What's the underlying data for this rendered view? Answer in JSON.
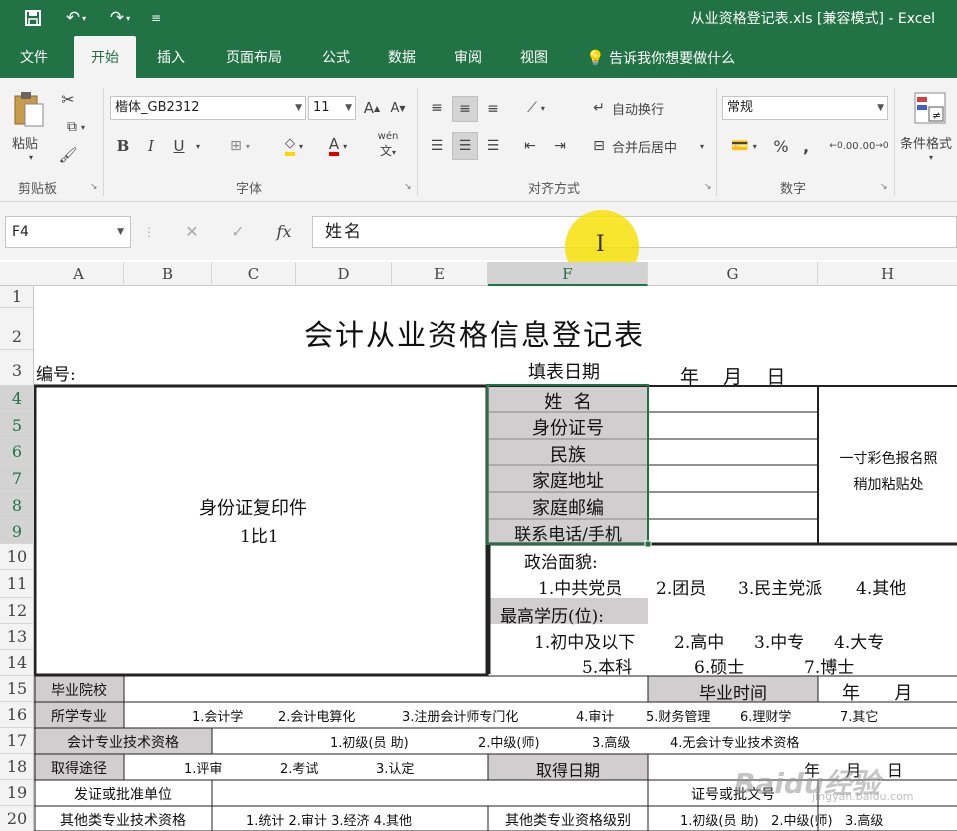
{
  "app": {
    "doc_title": "从业资格登记表.xls  [兼容模式]  -  Excel",
    "accent": "#217346"
  },
  "quick_access": {
    "save_icon": "save-icon",
    "undo_icon": "undo-icon",
    "redo_icon": "redo-icon",
    "customize_icon": "customize-icon"
  },
  "tabs": [
    {
      "label": "文件"
    },
    {
      "label": "开始",
      "active": true
    },
    {
      "label": "插入"
    },
    {
      "label": "页面布局"
    },
    {
      "label": "公式"
    },
    {
      "label": "数据"
    },
    {
      "label": "审阅"
    },
    {
      "label": "视图"
    }
  ],
  "tell_me": "告诉我你想要做什么",
  "ribbon": {
    "clipboard": {
      "paste": "粘贴",
      "label": "剪贴板"
    },
    "font": {
      "name": "楷体_GB2312",
      "size": "11",
      "bold": "B",
      "italic": "I",
      "underline": "U",
      "phonetic": "wén",
      "label": "字体"
    },
    "alignment": {
      "wrap": "自动换行",
      "merge": "合并后居中",
      "label": "对齐方式"
    },
    "number": {
      "format": "常规",
      "percent": "%",
      "comma": ",",
      "inc_decimal": ".00",
      "dec_decimal": ".00",
      "label": "数字"
    },
    "styles": {
      "conditional": "条件格式"
    }
  },
  "formula_bar": {
    "name_box": "F4",
    "fx": "fx",
    "content": "姓名"
  },
  "columns": [
    "A",
    "B",
    "C",
    "D",
    "E",
    "F",
    "G",
    "H"
  ],
  "selected_column": "F",
  "rows": [
    "1",
    "2",
    "3",
    "4",
    "5",
    "6",
    "7",
    "8",
    "9",
    "10",
    "11",
    "12",
    "13",
    "14",
    "15",
    "16",
    "17",
    "18",
    "19",
    "20"
  ],
  "sheet": {
    "title": "会计从业资格信息登记表",
    "number_label": "编号:",
    "fill_date_label": "填表日期",
    "date_placeholder": "年    月    日",
    "id_copy": "身份证复印件",
    "id_ratio": "1比1",
    "fields": [
      "姓  名",
      "身份证号",
      "民族",
      "家庭地址",
      "家庭邮编",
      "联系电话/手机"
    ],
    "photo_line1": "一寸彩色报名照",
    "photo_line2": "稍加粘贴处",
    "political_label": "政治面貌:",
    "political_options": [
      "1.中共党员",
      "2.团员",
      "3.民主党派",
      "4.其他"
    ],
    "education_label": "最高学历(位):",
    "education_row1": [
      "1.初中及以下",
      "2.高中",
      "3.中专",
      "4.大专"
    ],
    "education_row2": [
      "5.本科",
      "6.硕士",
      "7.博士"
    ],
    "school_label": "毕业院校",
    "grad_time_label": "毕业时间",
    "grad_time_placeholder": "年      月",
    "major_label": "所学专业",
    "major_options": [
      "1.会计学",
      "2.会计电算化",
      "3.注册会计师专门化",
      "4.审计",
      "5.财务管理",
      "6.理财学",
      "7.其它"
    ],
    "tech_label": "会计专业技术资格",
    "tech_options": [
      "1.初级(员 助)",
      "2.中级(师)",
      "3.高级",
      "4.无会计专业技术资格"
    ],
    "obtain_label": "取得途径",
    "obtain_options": [
      "1.评审",
      "2.考试",
      "3.认定"
    ],
    "obtain_date_label": "取得日期",
    "obtain_date_placeholder": "年     月     日",
    "issuer_label": "发证或批准单位",
    "cert_no_label": "证号或批文号",
    "other_tech_label": "其他类专业技术资格",
    "other_tech_options": "1.统计 2.审计 3.经济 4.其他",
    "other_level_label": "其他类专业资格级别",
    "other_level_options": "1.初级(员 助)   2.中级(师)   3.高级"
  },
  "watermark": {
    "text": "Baidu经验",
    "sub": "jingyan.baidu.com"
  }
}
